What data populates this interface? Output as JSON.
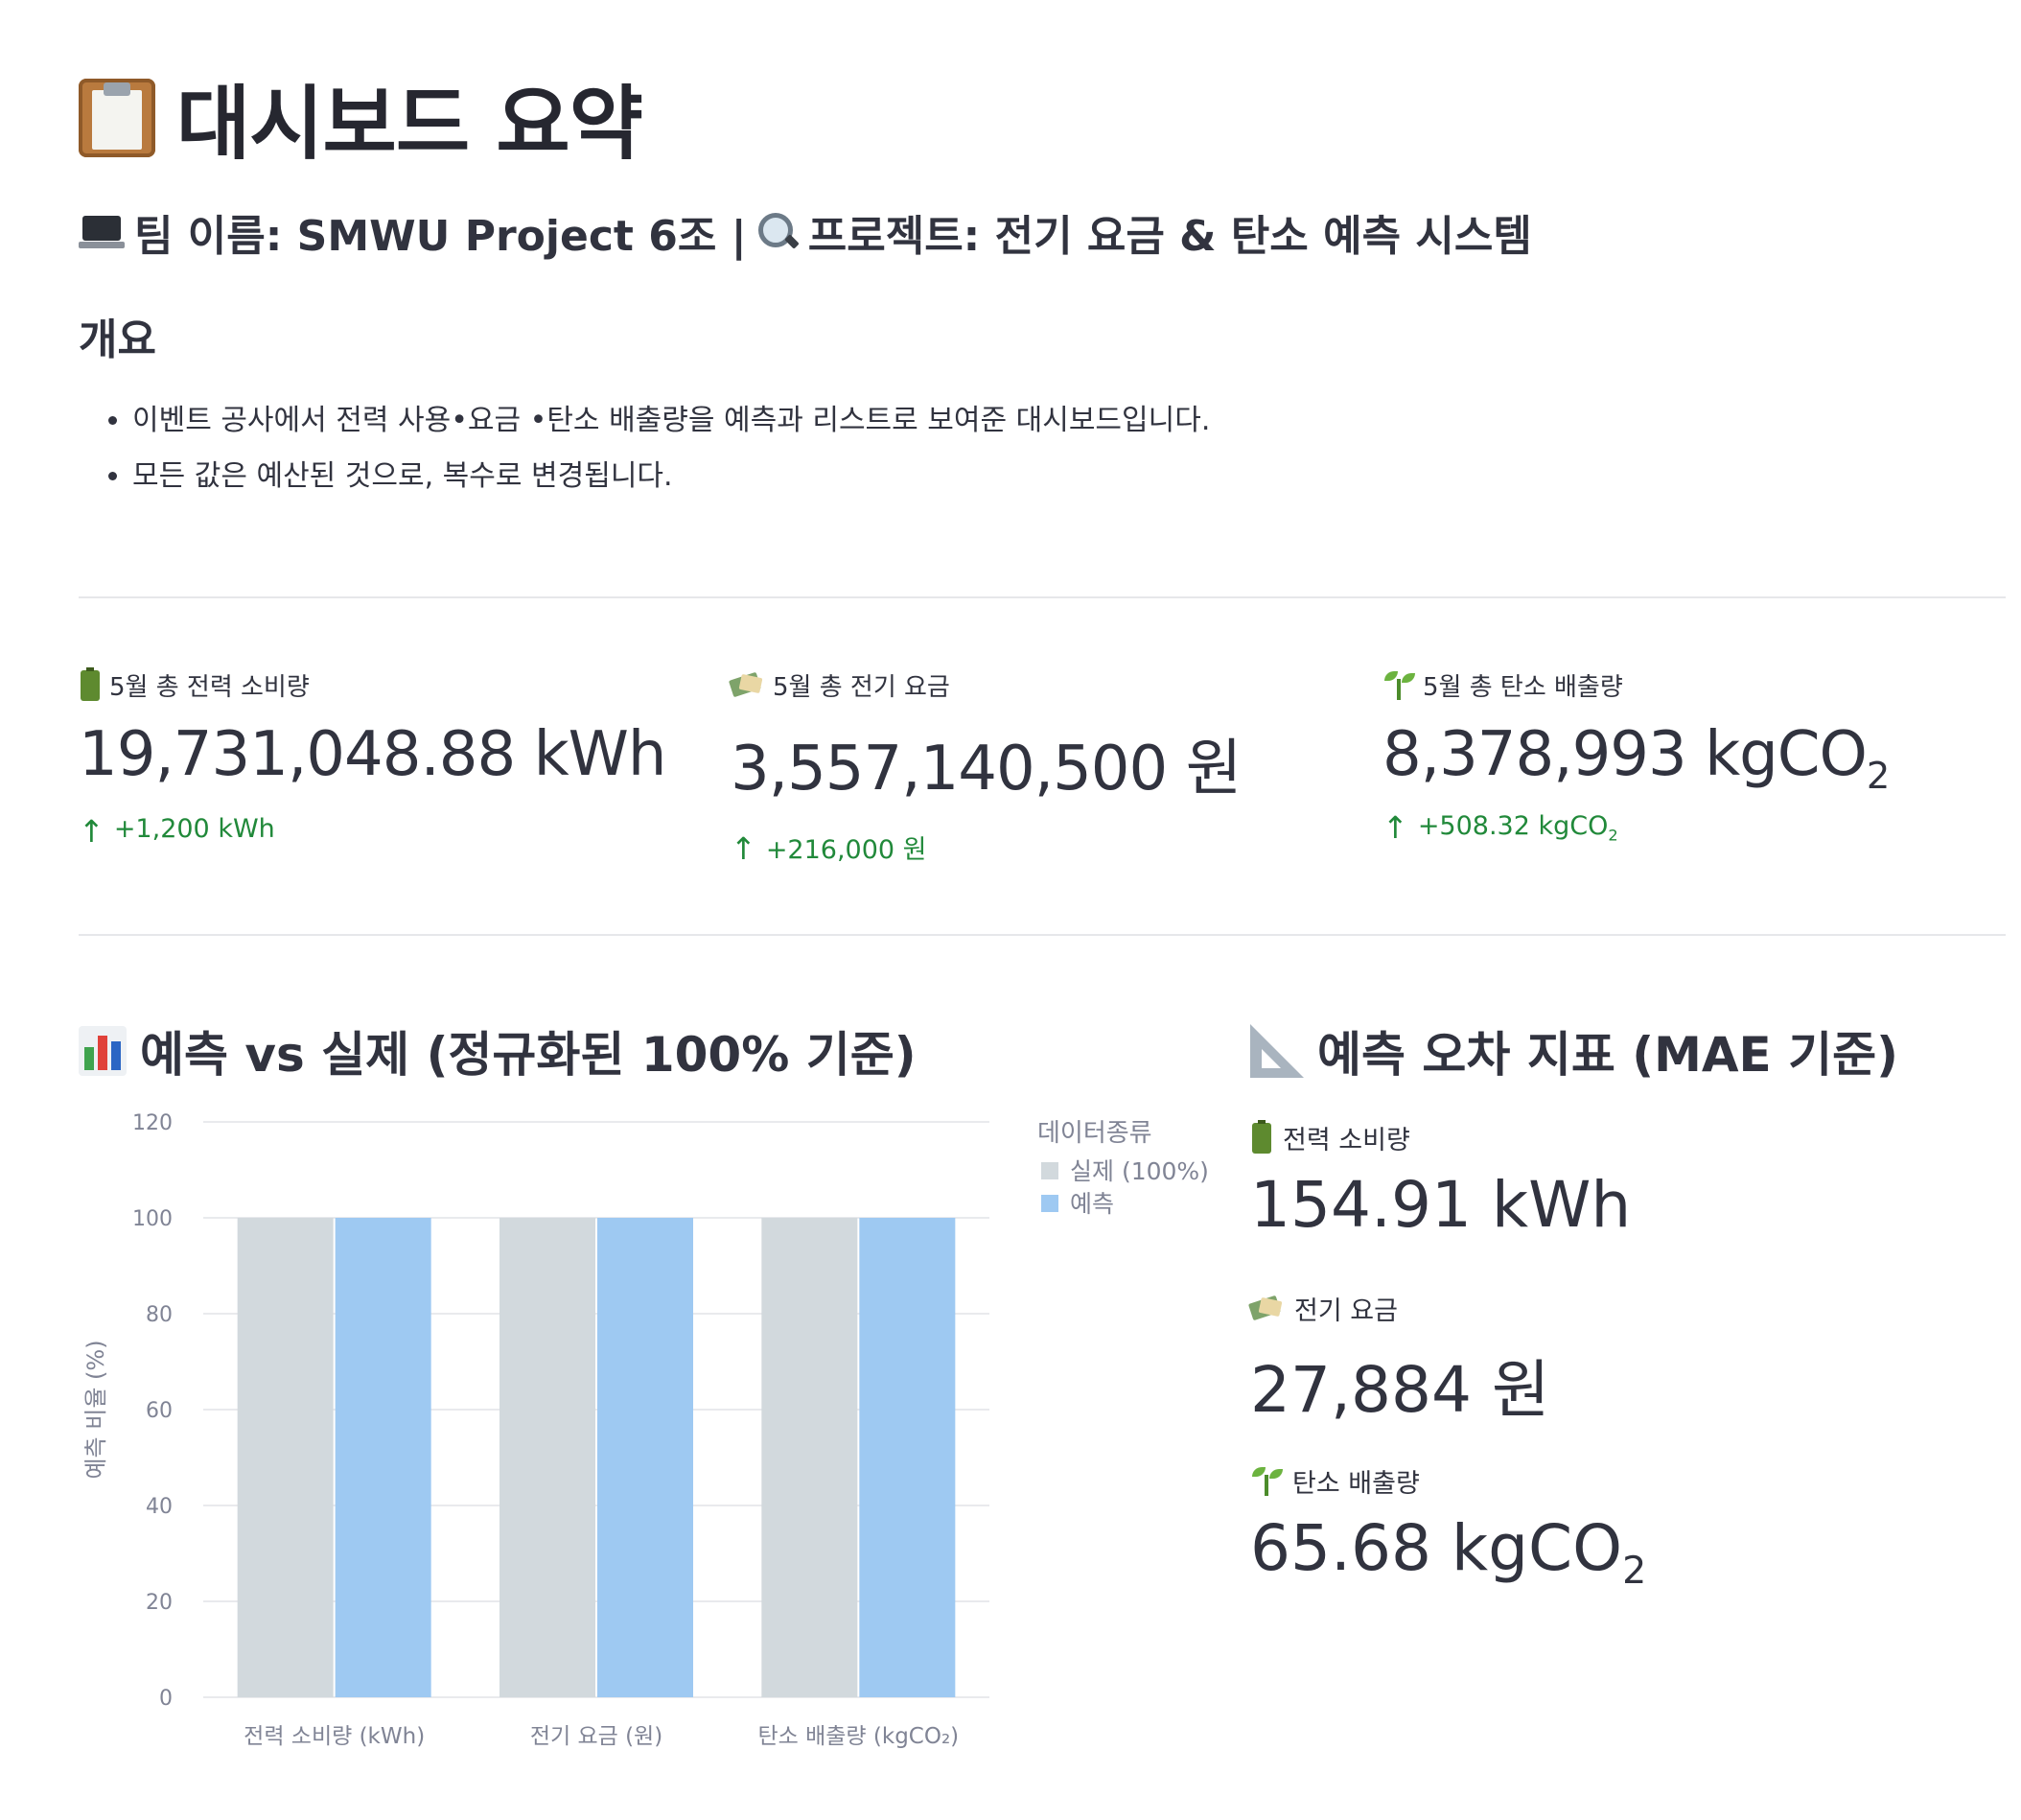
{
  "header": {
    "title": "대시보드 요약",
    "title_icon": "clipboard-icon",
    "team_label": "팀 이름: SMWU Project 6조 |",
    "project_label": "프로젝트: 전기 요금 & 탄소 예측 시스템"
  },
  "overview": {
    "heading": "개요",
    "bullets": [
      "이벤트 공사에서 전력 사용•요금 •탄소 배출량을 예측과 리스트로 보여준 대시보드입니다.",
      "모든 값은 예산된 것으로, 복수로 변경됩니다."
    ]
  },
  "metrics": [
    {
      "icon": "battery-icon",
      "label": "5월 총 전력 소비량",
      "value_main": "19,731,048.88 kWh",
      "value_sub": "",
      "delta_main": "+1,200 kWh",
      "delta_sub": ""
    },
    {
      "icon": "money-icon",
      "label": "5월 총 전기 요금",
      "value_main": "3,557,140,500 원",
      "value_sub": "",
      "delta_main": "+216,000 원",
      "delta_sub": ""
    },
    {
      "icon": "sprout-icon",
      "label": "5월 총 탄소 배출량",
      "value_main": "8,378,993 kgCO",
      "value_sub": "2",
      "delta_main": "+508.32 kgCO",
      "delta_sub": "2"
    }
  ],
  "chart_section": {
    "title": "예측 vs 실제 (정규화된 100% 기준)"
  },
  "chart_data": {
    "type": "bar",
    "categories": [
      "전력 소비량 (kWh)",
      "전기 요금 (원)",
      "탄소 배출량 (kgCO₂)"
    ],
    "series": [
      {
        "name": "실제 (100%)",
        "values": [
          100,
          100,
          100
        ],
        "color": "#d2d9dd"
      },
      {
        "name": "예측",
        "values": [
          100,
          100,
          100
        ],
        "color": "#9ec9f2"
      }
    ],
    "ylabel": "예측 비율 (%)",
    "xlabel": "",
    "ylim": [
      0,
      120
    ],
    "yticks": [
      0,
      20,
      40,
      60,
      80,
      100,
      120
    ],
    "legend_title": "데이터종류",
    "legend_position": "top-right",
    "grid": true
  },
  "error_section": {
    "title": "예측 오차 지표 (MAE 기준)",
    "items": [
      {
        "icon": "battery-icon",
        "label": "전력 소비량",
        "value_main": "154.91 kWh",
        "value_sub": ""
      },
      {
        "icon": "money-icon",
        "label": "전기 요금",
        "value_main": "27,884 원",
        "value_sub": ""
      },
      {
        "icon": "sprout-icon",
        "label": "탄소 배출량",
        "value_main": "65.68 kgCO",
        "value_sub": "2"
      }
    ]
  },
  "colors": {
    "delta_positive": "#21893a",
    "text": "#31333f",
    "divider": "#e6e7ea"
  }
}
